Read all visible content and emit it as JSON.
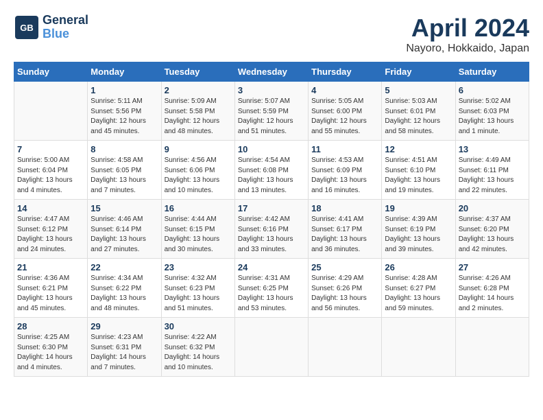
{
  "header": {
    "logo_line1": "General",
    "logo_line2": "Blue",
    "month_title": "April 2024",
    "location": "Nayoro, Hokkaido, Japan"
  },
  "weekdays": [
    "Sunday",
    "Monday",
    "Tuesday",
    "Wednesday",
    "Thursday",
    "Friday",
    "Saturday"
  ],
  "weeks": [
    [
      {
        "num": "",
        "info": ""
      },
      {
        "num": "1",
        "info": "Sunrise: 5:11 AM\nSunset: 5:56 PM\nDaylight: 12 hours\nand 45 minutes."
      },
      {
        "num": "2",
        "info": "Sunrise: 5:09 AM\nSunset: 5:58 PM\nDaylight: 12 hours\nand 48 minutes."
      },
      {
        "num": "3",
        "info": "Sunrise: 5:07 AM\nSunset: 5:59 PM\nDaylight: 12 hours\nand 51 minutes."
      },
      {
        "num": "4",
        "info": "Sunrise: 5:05 AM\nSunset: 6:00 PM\nDaylight: 12 hours\nand 55 minutes."
      },
      {
        "num": "5",
        "info": "Sunrise: 5:03 AM\nSunset: 6:01 PM\nDaylight: 12 hours\nand 58 minutes."
      },
      {
        "num": "6",
        "info": "Sunrise: 5:02 AM\nSunset: 6:03 PM\nDaylight: 13 hours\nand 1 minute."
      }
    ],
    [
      {
        "num": "7",
        "info": "Sunrise: 5:00 AM\nSunset: 6:04 PM\nDaylight: 13 hours\nand 4 minutes."
      },
      {
        "num": "8",
        "info": "Sunrise: 4:58 AM\nSunset: 6:05 PM\nDaylight: 13 hours\nand 7 minutes."
      },
      {
        "num": "9",
        "info": "Sunrise: 4:56 AM\nSunset: 6:06 PM\nDaylight: 13 hours\nand 10 minutes."
      },
      {
        "num": "10",
        "info": "Sunrise: 4:54 AM\nSunset: 6:08 PM\nDaylight: 13 hours\nand 13 minutes."
      },
      {
        "num": "11",
        "info": "Sunrise: 4:53 AM\nSunset: 6:09 PM\nDaylight: 13 hours\nand 16 minutes."
      },
      {
        "num": "12",
        "info": "Sunrise: 4:51 AM\nSunset: 6:10 PM\nDaylight: 13 hours\nand 19 minutes."
      },
      {
        "num": "13",
        "info": "Sunrise: 4:49 AM\nSunset: 6:11 PM\nDaylight: 13 hours\nand 22 minutes."
      }
    ],
    [
      {
        "num": "14",
        "info": "Sunrise: 4:47 AM\nSunset: 6:12 PM\nDaylight: 13 hours\nand 24 minutes."
      },
      {
        "num": "15",
        "info": "Sunrise: 4:46 AM\nSunset: 6:14 PM\nDaylight: 13 hours\nand 27 minutes."
      },
      {
        "num": "16",
        "info": "Sunrise: 4:44 AM\nSunset: 6:15 PM\nDaylight: 13 hours\nand 30 minutes."
      },
      {
        "num": "17",
        "info": "Sunrise: 4:42 AM\nSunset: 6:16 PM\nDaylight: 13 hours\nand 33 minutes."
      },
      {
        "num": "18",
        "info": "Sunrise: 4:41 AM\nSunset: 6:17 PM\nDaylight: 13 hours\nand 36 minutes."
      },
      {
        "num": "19",
        "info": "Sunrise: 4:39 AM\nSunset: 6:19 PM\nDaylight: 13 hours\nand 39 minutes."
      },
      {
        "num": "20",
        "info": "Sunrise: 4:37 AM\nSunset: 6:20 PM\nDaylight: 13 hours\nand 42 minutes."
      }
    ],
    [
      {
        "num": "21",
        "info": "Sunrise: 4:36 AM\nSunset: 6:21 PM\nDaylight: 13 hours\nand 45 minutes."
      },
      {
        "num": "22",
        "info": "Sunrise: 4:34 AM\nSunset: 6:22 PM\nDaylight: 13 hours\nand 48 minutes."
      },
      {
        "num": "23",
        "info": "Sunrise: 4:32 AM\nSunset: 6:23 PM\nDaylight: 13 hours\nand 51 minutes."
      },
      {
        "num": "24",
        "info": "Sunrise: 4:31 AM\nSunset: 6:25 PM\nDaylight: 13 hours\nand 53 minutes."
      },
      {
        "num": "25",
        "info": "Sunrise: 4:29 AM\nSunset: 6:26 PM\nDaylight: 13 hours\nand 56 minutes."
      },
      {
        "num": "26",
        "info": "Sunrise: 4:28 AM\nSunset: 6:27 PM\nDaylight: 13 hours\nand 59 minutes."
      },
      {
        "num": "27",
        "info": "Sunrise: 4:26 AM\nSunset: 6:28 PM\nDaylight: 14 hours\nand 2 minutes."
      }
    ],
    [
      {
        "num": "28",
        "info": "Sunrise: 4:25 AM\nSunset: 6:30 PM\nDaylight: 14 hours\nand 4 minutes."
      },
      {
        "num": "29",
        "info": "Sunrise: 4:23 AM\nSunset: 6:31 PM\nDaylight: 14 hours\nand 7 minutes."
      },
      {
        "num": "30",
        "info": "Sunrise: 4:22 AM\nSunset: 6:32 PM\nDaylight: 14 hours\nand 10 minutes."
      },
      {
        "num": "",
        "info": ""
      },
      {
        "num": "",
        "info": ""
      },
      {
        "num": "",
        "info": ""
      },
      {
        "num": "",
        "info": ""
      }
    ]
  ]
}
